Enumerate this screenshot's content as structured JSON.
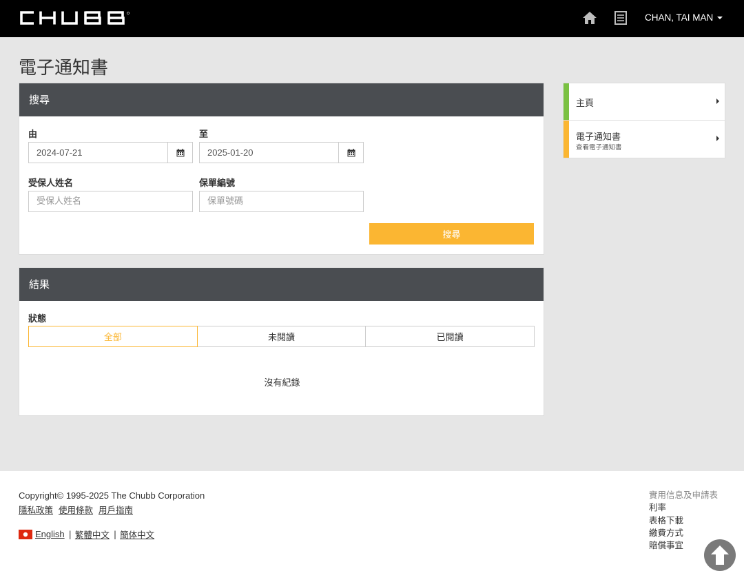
{
  "header": {
    "logo_text": "CHUBB",
    "user_name": "CHAN, TAI MAN"
  },
  "page": {
    "title": "電子通知書"
  },
  "search_panel": {
    "header": "搜尋",
    "from_label": "由",
    "from_value": "2024-07-21",
    "to_label": "至",
    "to_value": "2025-01-20",
    "insured_label": "受保人姓名",
    "insured_placeholder": "受保人姓名",
    "policy_label": "保單編號",
    "policy_placeholder": "保單號碼",
    "search_button": "搜尋"
  },
  "results_panel": {
    "header": "結果",
    "status_label": "狀態",
    "tabs": [
      {
        "label": "全部",
        "active": true
      },
      {
        "label": "未閱讀",
        "active": false
      },
      {
        "label": "已閱讀",
        "active": false
      }
    ],
    "empty_text": "沒有紀錄"
  },
  "side_nav": {
    "items": [
      {
        "title": "主頁",
        "subtitle": "",
        "color": "#7ac142"
      },
      {
        "title": "電子通知書",
        "subtitle": "查看電子通知書",
        "color": "#fbb632"
      }
    ]
  },
  "footer": {
    "copyright": "Copyright© 1995-2025 The Chubb Corporation",
    "links": [
      "隱私政策",
      "使用條款",
      "用戶指南"
    ],
    "languages": [
      "English",
      "繁體中文",
      "簡体中文"
    ],
    "useful_heading": "實用信息及申請表",
    "useful_links": [
      "利率",
      "表格下載",
      "繳費方式",
      "賠償事宜"
    ]
  },
  "colors": {
    "accent": "#fbb632",
    "header_bg": "#000000",
    "panel_header": "#4a4d51"
  }
}
